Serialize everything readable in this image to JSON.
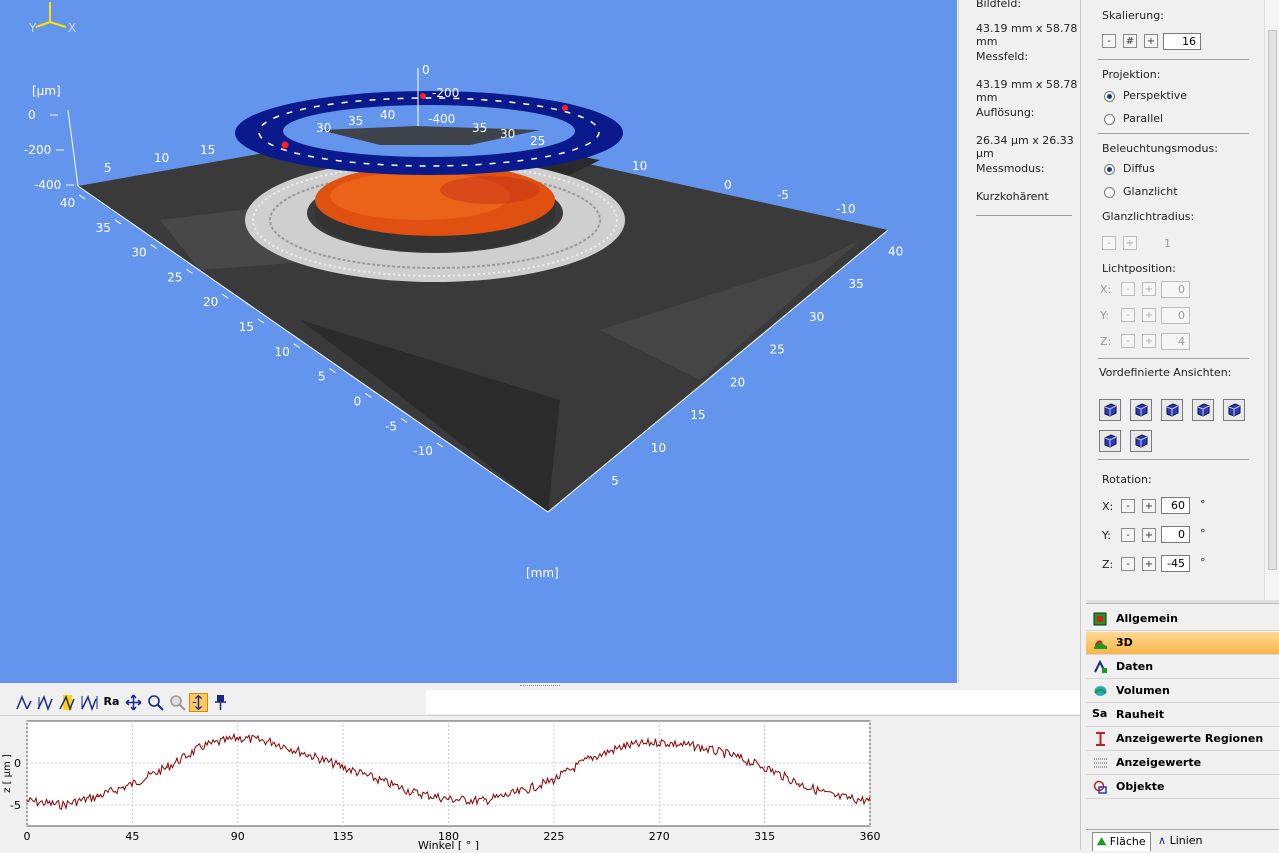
{
  "viewport": {
    "unit_z": "[µm]",
    "unit_xy": "[mm]",
    "axis_triad": {
      "x": "X",
      "y": "Y"
    },
    "z_ticks": [
      "0",
      "-200",
      "-400"
    ],
    "left_axis_ticks": [
      "40",
      "35",
      "30",
      "25",
      "20",
      "15",
      "10",
      "5",
      "0",
      "-5",
      "-10"
    ],
    "right_axis_ticks": [
      "40",
      "35",
      "30",
      "25",
      "20",
      "15",
      "10",
      "5"
    ],
    "back_left_ticks": [
      "5",
      "10",
      "15"
    ],
    "back_right_ticks": [
      "10",
      "0",
      "-5",
      "-10"
    ],
    "ring_labels": [
      "0",
      "-200",
      "-400",
      "30",
      "35",
      "40",
      "35",
      "30",
      "25"
    ],
    "colors": {
      "background": "#6495ed",
      "ring": "#0a1a8c",
      "hotspot": "#e84a10",
      "surface": "#3a3a3a"
    }
  },
  "info": {
    "bildfeld_label": "Bildfeld:",
    "bildfeld_value": "43.19 mm x 58.78 mm",
    "messfeld_label": "Messfeld:",
    "messfeld_value": "43.19 mm x 58.78 mm",
    "aufloesung_label": "Auflösung:",
    "aufloesung_value": "26.34 µm x 26.33 µm",
    "messmodus_label": "Messmodus:",
    "messmodus_value": "Kurzkohärent"
  },
  "settings": {
    "skalierung_label": "Skalierung:",
    "skalierung_minus": "-",
    "skalierung_hash": "#",
    "skalierung_plus": "+",
    "skalierung_value": "16",
    "projektion_label": "Projektion:",
    "projektion_options": [
      "Perspektive",
      "Parallel"
    ],
    "projektion_selected": "Perspektive",
    "beleuchtung_label": "Beleuchtungsmodus:",
    "beleuchtung_options": [
      "Diffus",
      "Glanzlicht"
    ],
    "beleuchtung_selected": "Diffus",
    "glanzlichtradius_label": "Glanzlichtradius:",
    "glanzlichtradius_value": "1",
    "lichtposition_label": "Lichtposition:",
    "licht_x_label": "X:",
    "licht_x": "0",
    "licht_y_label": "Y:",
    "licht_y": "0",
    "licht_z_label": "Z:",
    "licht_z": "4",
    "ansichten_label": "Vordefinierte Ansichten:",
    "rotation_label": "Rotation:",
    "rot_x_label": "X:",
    "rot_x": "60",
    "rot_y_label": "Y:",
    "rot_y": "0",
    "rot_z_label": "Z:",
    "rot_z": "-45",
    "degree": "°",
    "minus": "-",
    "plus": "+"
  },
  "nav": {
    "items": [
      "Allgemein",
      "3D",
      "Daten",
      "Volumen",
      "Rauheit",
      "Anzeigewerte Regionen",
      "Anzeigewerte",
      "Objekte"
    ],
    "active": "3D",
    "rauheit_icon_text": "Sa"
  },
  "tabs": {
    "flaeche": "Fläche",
    "linien": "Linien"
  },
  "toolbar": {
    "ra": "Ra"
  },
  "chart_data": {
    "type": "line",
    "xlabel": "Winkel [ ° ]",
    "ylabel": "z [ µm ]",
    "xlim": [
      0,
      360
    ],
    "ylim": [
      -7.5,
      5
    ],
    "x_ticks": [
      0,
      45,
      90,
      135,
      180,
      225,
      270,
      315,
      360
    ],
    "y_ticks": [
      0,
      -5
    ],
    "grid": true,
    "series": [
      {
        "color": "#8b0000",
        "x": [
          0,
          15,
          30,
          45,
          60,
          75,
          90,
          105,
          120,
          135,
          150,
          165,
          180,
          195,
          210,
          225,
          240,
          255,
          270,
          285,
          300,
          315,
          330,
          345,
          360
        ],
        "values": [
          -4.5,
          -5.0,
          -4.0,
          -2.5,
          -0.5,
          2.0,
          3.0,
          2.5,
          1.0,
          -0.5,
          -2.0,
          -3.5,
          -4.3,
          -4.5,
          -3.5,
          -2.0,
          0.5,
          2.0,
          2.5,
          2.0,
          1.0,
          -0.5,
          -2.5,
          -4.0,
          -4.5
        ]
      }
    ]
  }
}
